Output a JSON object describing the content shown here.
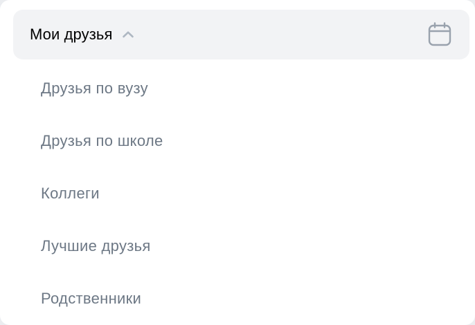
{
  "header": {
    "title": "Мои друзья",
    "chevron_icon": "chevron-up-icon",
    "action_icon": "calendar-icon"
  },
  "list": {
    "items": [
      {
        "label": "Друзья по вузу"
      },
      {
        "label": "Друзья по школе"
      },
      {
        "label": "Коллеги"
      },
      {
        "label": "Лучшие друзья"
      },
      {
        "label": "Родственники"
      }
    ]
  },
  "colors": {
    "background": "#ffffff",
    "header_background": "#f2f3f5",
    "title_text": "#000000",
    "item_text": "#6d7885",
    "icon": "#aeb7c2"
  }
}
